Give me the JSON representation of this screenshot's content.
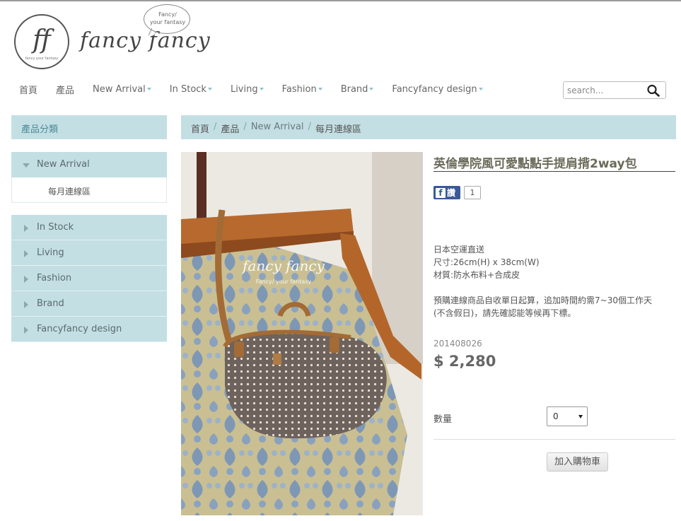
{
  "header": {
    "logo_mark": "ff",
    "logo_small_text": "fancy your fantasy",
    "brand": "fancy fancy",
    "bubble_line1": "Fancy/",
    "bubble_line2": "your fantasy"
  },
  "nav": {
    "items": [
      {
        "label": "首頁",
        "caret": false
      },
      {
        "label": "產品",
        "caret": false
      },
      {
        "label": "New Arrival",
        "caret": true
      },
      {
        "label": "In Stock",
        "caret": true
      },
      {
        "label": "Living",
        "caret": true
      },
      {
        "label": "Fashion",
        "caret": true
      },
      {
        "label": "Brand",
        "caret": true
      },
      {
        "label": "Fancyfancy design",
        "caret": true
      }
    ],
    "search_placeholder": "search..."
  },
  "sidebar": {
    "heading": "產品分類",
    "open_category": "New Arrival",
    "sub_item": "每月連線區",
    "categories": [
      "In Stock",
      "Living",
      "Fashion",
      "Brand",
      "Fancyfancy design"
    ]
  },
  "breadcrumb": {
    "items": [
      "首頁",
      "產品",
      "New Arrival",
      "每月連線區"
    ]
  },
  "photo": {
    "watermark": "fancy fancy",
    "watermark_sub": "Fancy/ your fantasy"
  },
  "product": {
    "title": "英倫學院風可愛點點手提肩揹2way包",
    "fb_share": "讚",
    "fb_count": "1",
    "desc": [
      "日本空運直送",
      "尺寸:26cm(H) x 38cm(W)",
      "材質:防水布料+合成皮",
      "",
      "預購連線商品自收單日起算，追加時間約需7~30個工作天",
      "(不含假日)，請先確認能等候再下標。"
    ],
    "sku": "201408026",
    "price": "$ 2,280",
    "qty_label": "數量",
    "qty_value": "0",
    "add_to_cart": "加入購物車"
  },
  "colors": {
    "sidebar_bg": "#c3dfe3",
    "nav_caret": "#8ec3d3",
    "fb_blue": "#3b5998"
  }
}
